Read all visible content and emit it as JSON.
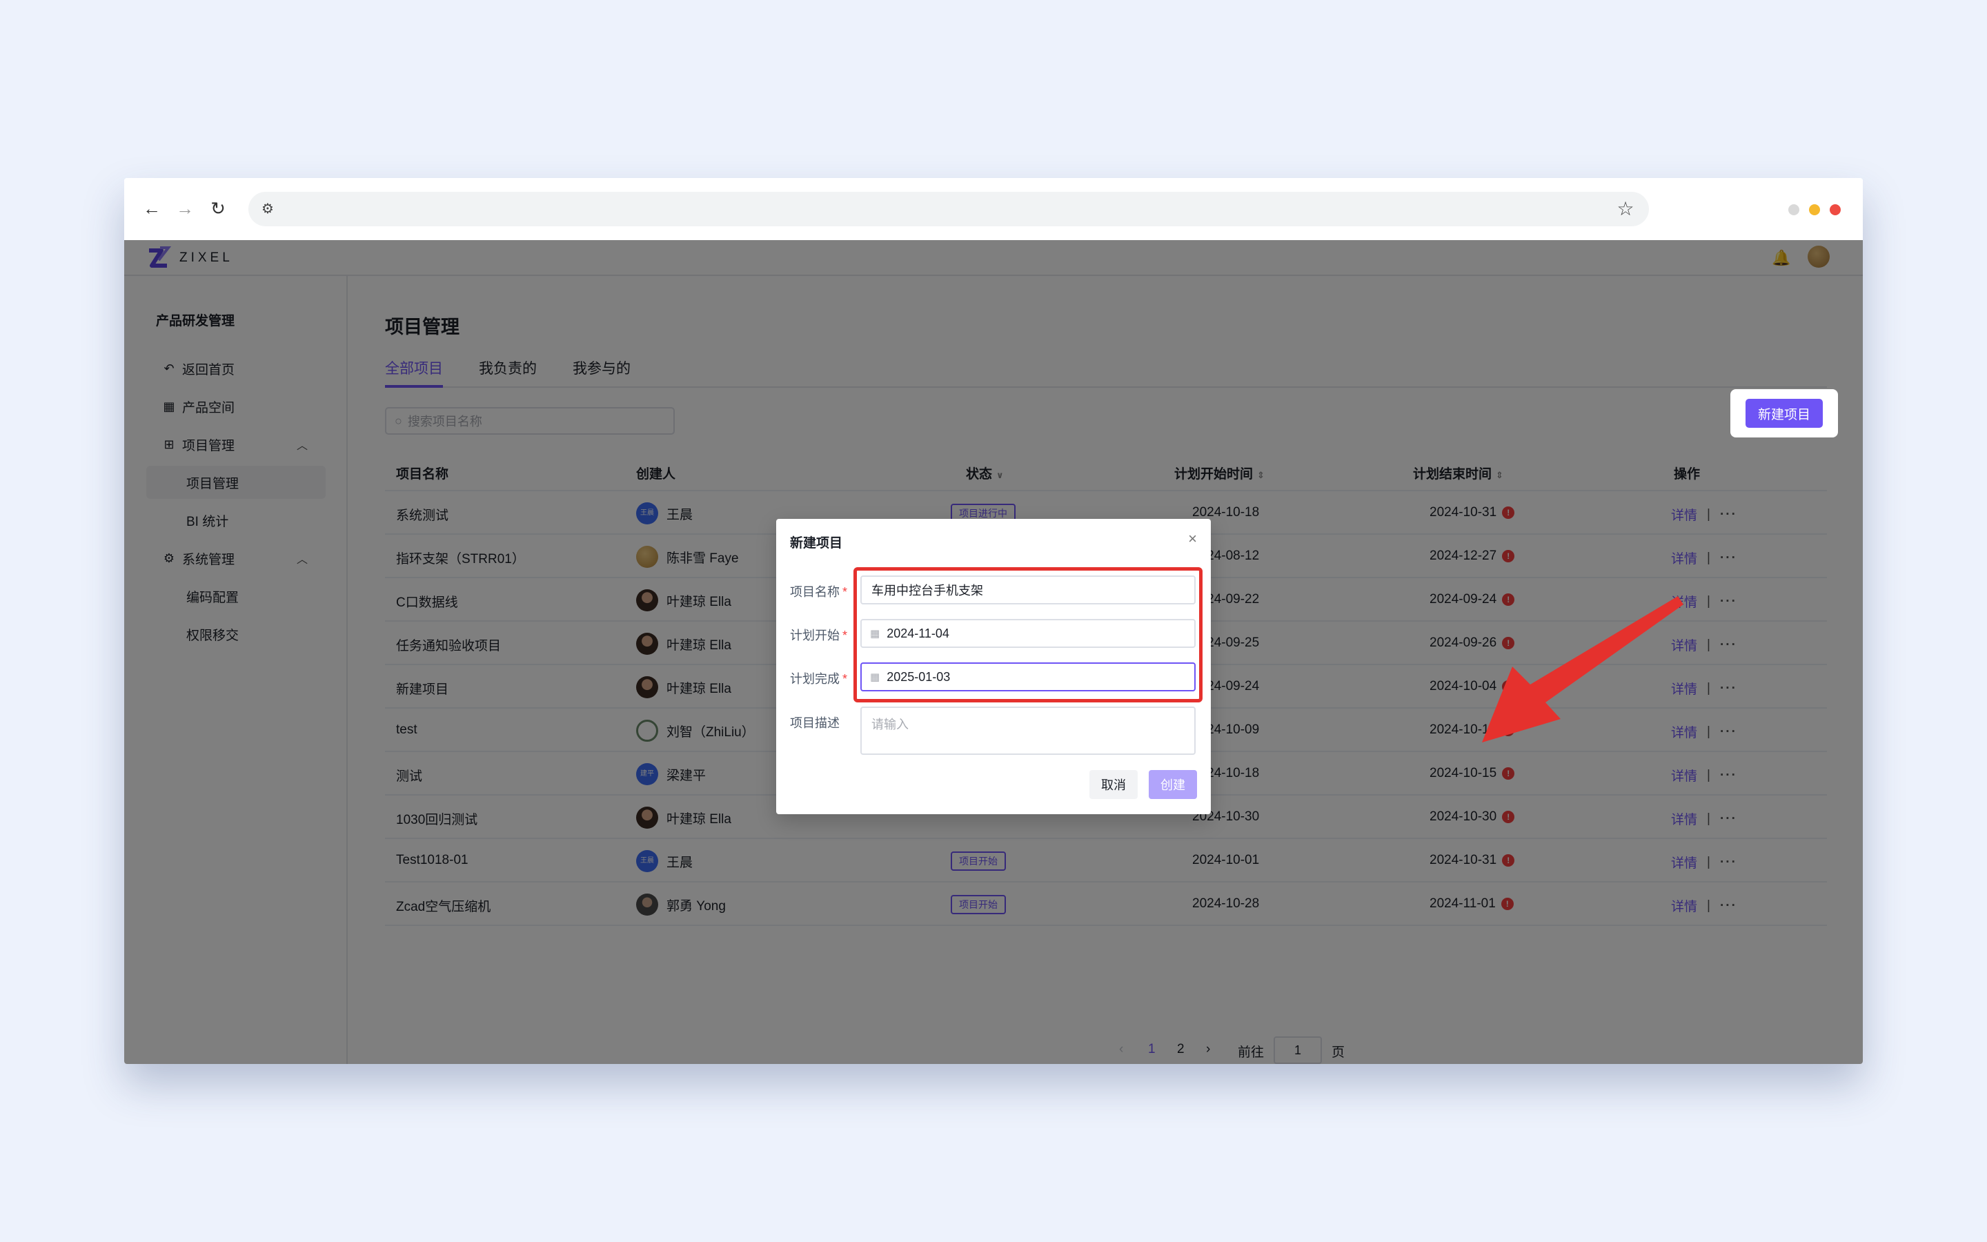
{
  "app": {
    "logo_text": "ZIXEL",
    "sidebar": {
      "title": "产品研发管理",
      "items": [
        {
          "label": "返回首页"
        },
        {
          "label": "产品空间"
        },
        {
          "label": "项目管理"
        },
        {
          "label": "项目管理"
        },
        {
          "label": "BI 统计"
        },
        {
          "label": "系统管理"
        },
        {
          "label": "编码配置"
        },
        {
          "label": "权限移交"
        }
      ]
    },
    "page_title": "项目管理",
    "tabs": [
      "全部项目",
      "我负责的",
      "我参与的"
    ],
    "search_placeholder": "搜索项目名称",
    "new_button": "新建项目",
    "columns": [
      "项目名称",
      "创建人",
      "状态",
      "计划开始时间",
      "计划结束时间",
      "操作"
    ],
    "rows": [
      {
        "name": "系统测试",
        "creator": "王晨",
        "avatar_text": "王晨",
        "status": "项目进行中",
        "start": "2024-10-18",
        "end": "2024-10-31"
      },
      {
        "name": "指环支架（STRR01）",
        "creator": "陈非雪 Faye",
        "status": "",
        "start": "2024-08-12",
        "end": "2024-12-27"
      },
      {
        "name": "C口数据线",
        "creator": "叶建琼 Ella",
        "status": "",
        "start": "2024-09-22",
        "end": "2024-09-24"
      },
      {
        "name": "任务通知验收项目",
        "creator": "叶建琼 Ella",
        "status": "",
        "start": "2024-09-25",
        "end": "2024-09-26"
      },
      {
        "name": "新建项目",
        "creator": "叶建琼 Ella",
        "status": "",
        "start": "2024-09-24",
        "end": "2024-10-04"
      },
      {
        "name": "test",
        "creator": "刘智（ZhiLiu）",
        "status": "",
        "start": "2024-10-09",
        "end": "2024-10-10"
      },
      {
        "name": "测试",
        "creator": "梁建平",
        "avatar_text": "建平",
        "status": "",
        "start": "2024-10-18",
        "end": "2024-10-15"
      },
      {
        "name": "1030回归测试",
        "creator": "叶建琼 Ella",
        "status": "",
        "start": "2024-10-30",
        "end": "2024-10-30"
      },
      {
        "name": "Test1018-01",
        "creator": "王晨",
        "avatar_text": "王晨",
        "status": "项目开始",
        "start": "2024-10-01",
        "end": "2024-10-31"
      },
      {
        "name": "Zcad空气压缩机",
        "creator": "郭勇 Yong",
        "status": "项目开始",
        "start": "2024-10-28",
        "end": "2024-11-01"
      }
    ],
    "row_actions": {
      "detail": "详情",
      "separator": "|",
      "more": "···"
    },
    "warn_mark": "!",
    "pagination": {
      "prev": "‹",
      "pages": [
        "1",
        "2"
      ],
      "next": "›",
      "goto_label": "前往",
      "goto_value": "1",
      "page_suffix": "页"
    }
  },
  "modal": {
    "title": "新建项目",
    "fields": [
      {
        "label": "项目名称",
        "required_mark": "*",
        "value": "车用中控台手机支架"
      },
      {
        "label": "计划开始",
        "required_mark": "*",
        "value": "2024-11-04"
      },
      {
        "label": "计划完成",
        "required_mark": "*",
        "value": "2025-01-03"
      },
      {
        "label": "项目描述",
        "placeholder": "请输入"
      }
    ],
    "cancel_label": "取消",
    "create_label": "创建"
  },
  "colors": {
    "accent": "#6e54f5",
    "highlight": "#e5312d",
    "warn": "#f53f3f"
  }
}
